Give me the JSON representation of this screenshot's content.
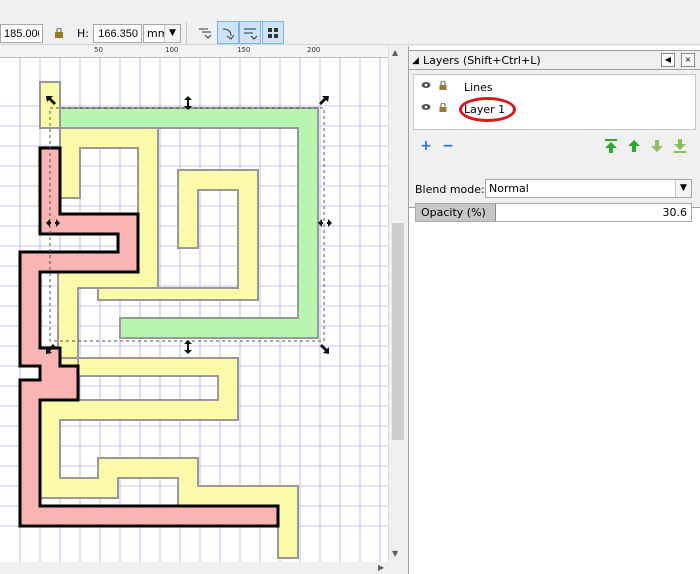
{
  "toolbar": {
    "x_value": "185.000",
    "h_label": "H:",
    "h_value": "166.350",
    "unit": "mm",
    "ruler_labels": [
      "50",
      "100",
      "150",
      "200"
    ]
  },
  "layers_panel": {
    "title": "Layers (Shift+Ctrl+L)",
    "layers": [
      {
        "name": "Lines"
      },
      {
        "name": "Layer 1",
        "highlighted": true
      }
    ],
    "blend_label": "Blend mode:",
    "blend_value": "Normal",
    "opacity_label": "Opacity (%)",
    "opacity_value": "30.6",
    "opacity_fraction": 0.306
  },
  "colors": {
    "green_fill": "#b7f5b0",
    "yellow_fill": "#fbfaa9",
    "pink_fill": "#f9b4b4",
    "highlight_ring": "#e0141b",
    "grid_line": "#7070d0"
  },
  "icons": [
    "lock-icon",
    "eye-icon",
    "add-icon",
    "remove-icon",
    "raise-to-top-icon",
    "raise-icon",
    "lower-icon",
    "lower-to-bottom-icon"
  ]
}
